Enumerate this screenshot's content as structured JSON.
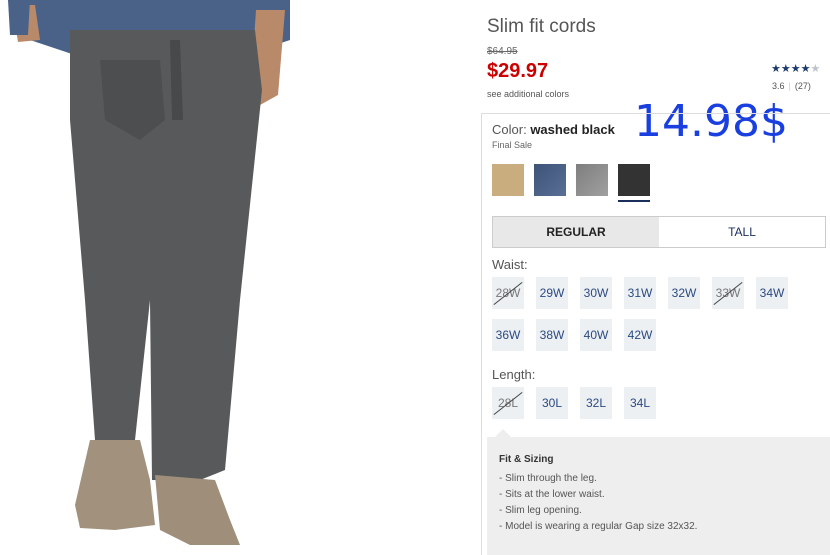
{
  "product": {
    "title": "Slim fit cords",
    "old_price": "$64.95",
    "price": "$29.97",
    "additional_colors": "see additional colors"
  },
  "rating": {
    "stars": 3.6,
    "value": "3.6",
    "count": "(27)"
  },
  "overlay_price": "14.98$",
  "color": {
    "label": "Color:",
    "name": "washed black",
    "note": "Final Sale",
    "swatches": [
      {
        "name": "khaki",
        "hex": "#c9ad7e"
      },
      {
        "name": "blue",
        "hex": "#4a5f85"
      },
      {
        "name": "gray",
        "hex": "#8c8c8c"
      },
      {
        "name": "washed black",
        "hex": "#333333",
        "selected": true
      }
    ]
  },
  "fit_tabs": [
    "REGULAR",
    "TALL"
  ],
  "waist": {
    "label": "Waist:",
    "sizes": [
      {
        "label": "28W",
        "available": false
      },
      {
        "label": "29W",
        "available": true
      },
      {
        "label": "30W",
        "available": true
      },
      {
        "label": "31W",
        "available": true
      },
      {
        "label": "32W",
        "available": true
      },
      {
        "label": "33W",
        "available": false
      },
      {
        "label": "34W",
        "available": true
      },
      {
        "label": "36W",
        "available": true
      },
      {
        "label": "38W",
        "available": true
      },
      {
        "label": "40W",
        "available": true
      },
      {
        "label": "42W",
        "available": true
      }
    ]
  },
  "length": {
    "label": "Length:",
    "sizes": [
      {
        "label": "28L",
        "available": false
      },
      {
        "label": "30L",
        "available": true
      },
      {
        "label": "32L",
        "available": true
      },
      {
        "label": "34L",
        "available": true
      }
    ]
  },
  "fit_sizing": {
    "title": "Fit & Sizing",
    "items": [
      "Slim through the leg.",
      "Sits at the lower waist.",
      "Slim leg opening.",
      "Model is wearing a regular Gap size 32x32."
    ]
  },
  "colors": {
    "price_red": "#cc0000",
    "overlay_blue": "#1a3fe0",
    "navy": "#1a2e5a"
  }
}
